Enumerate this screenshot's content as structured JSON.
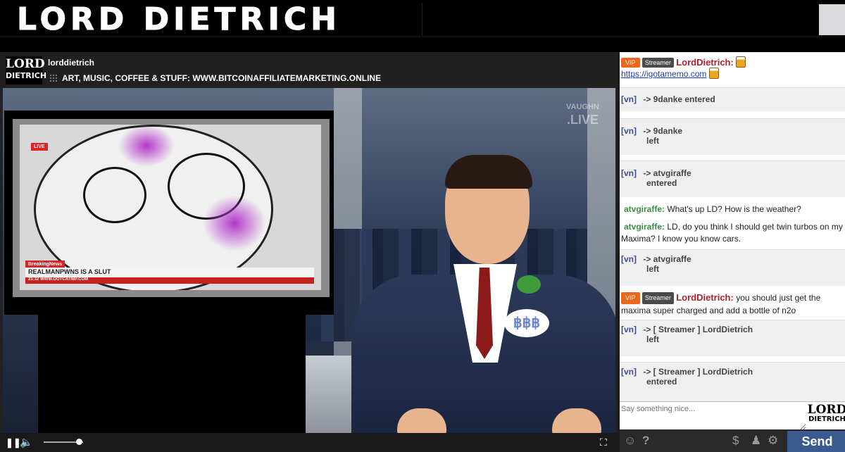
{
  "banner": {
    "title": "LORD DIETRICH"
  },
  "channel": {
    "logo_line1": "LORD",
    "logo_line2": "DIETRICH",
    "name": "lorddietrich",
    "topic": "ART, MUSIC, COFFEE & STUFF: WWW.BITCOINAFFILIATEMARKETING.ONLINE"
  },
  "video": {
    "watermark_line1": "VAUGHN",
    "watermark_line2": ".LIVE",
    "live_tag": "LIVE",
    "news_label": "BreakingNews",
    "news_headline": "REALMANPWNS IS A SLUT",
    "news_sub": "21:32  WWW.GOTCATNIP.COM",
    "pin_text": "฿฿฿",
    "volume_level": 0.9
  },
  "controls": {
    "pause_icon": "pause-icon",
    "volume_icon": "volume-icon",
    "fullscreen_icon": "fullscreen-icon"
  },
  "chat": {
    "messages": [
      {
        "badge_vip": "VIP",
        "badge_streamer": "Streamer",
        "nick": "LordDietrich:",
        "link": "https://igotamemo.com"
      },
      {
        "tag": "[vn]",
        "text": "-> 9danke entered"
      },
      {
        "tag": "[vn]",
        "text1": "-> 9danke",
        "text2": "left"
      },
      {
        "tag": "[vn]",
        "text1": "-> atvgiraffe",
        "text2": "entered"
      },
      {
        "nick": "atvgiraffe:",
        "text": "What's up LD? How is the weather?"
      },
      {
        "nick": "atvgiraffe:",
        "text": "LD, do you think I should get twin turbos on my Maxima? I know you know cars."
      },
      {
        "tag": "[vn]",
        "text1": "-> atvgiraffe",
        "text2": "left"
      },
      {
        "badge_vip": "VIP",
        "badge_streamer": "Streamer",
        "nick": "LordDietrich:",
        "text": "you should just get the maxima super charged and add a bottle of n2o"
      },
      {
        "tag": "[vn]",
        "text1": "-> [ Streamer ] LordDietrich",
        "text2": "left"
      },
      {
        "tag": "[vn]",
        "text1": "-> [ Streamer ] LordDietrich",
        "text2": "entered"
      }
    ],
    "input_placeholder": "Say something nice...",
    "logo_line1": "LORD",
    "logo_line2": "DIETRICH",
    "send_label": "Send"
  },
  "colors": {
    "vip": "#e8681e",
    "streamer_badge": "#4a4a4a",
    "streamer_nick": "#b21f2b",
    "user_nick": "#3b8f3e",
    "send_button": "#3b5a8f"
  }
}
